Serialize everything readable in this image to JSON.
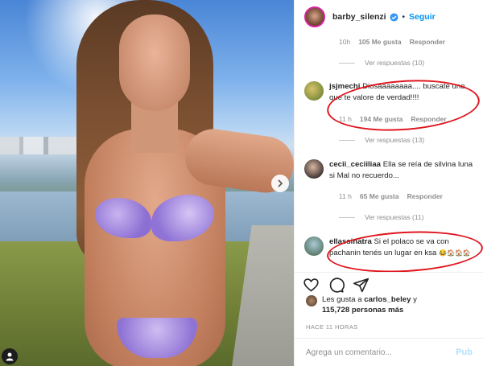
{
  "post": {
    "author": "barby_silenzi",
    "follow_label": "Seguir",
    "separator": "•"
  },
  "comment_top": {
    "time": "10h",
    "likes": "105 Me gusta",
    "reply_label": "Responder",
    "view_replies": "Ver respuestas (10)"
  },
  "comments": [
    {
      "user": "jsjmechi",
      "text": "Diosaaaaaaaa.... buscate uno que te valore de verdad!!!!",
      "time": "11 h",
      "likes": "194 Me gusta",
      "reply_label": "Responder",
      "view_replies": "Ver respuestas (13)"
    },
    {
      "user": "cecii_ceciiliaa",
      "text": "Ella se reía de silvina luna si Mal no recuerdo...",
      "time": "11 h",
      "likes": "65 Me gusta",
      "reply_label": "Responder",
      "view_replies": "Ver respuestas (11)"
    },
    {
      "user": "ellassinatra",
      "text": "Si el polaco se va con pachanin tenés un lugar en ksa",
      "emoji": "😂🏠🏠🏠"
    }
  ],
  "likes": {
    "prefix": "Les gusta a",
    "user": "carlos_beley",
    "conj": "y",
    "count": "115,728 personas más"
  },
  "posted": "HACE 11 HORAS",
  "add_comment": {
    "placeholder": "Agrega un comentario...",
    "publish": "Pub"
  },
  "colors": {
    "accent": "#0095f6",
    "annotation": "#e0161f",
    "muted": "#8e8e8e"
  },
  "icons": [
    "verified-badge-icon",
    "heart-icon",
    "comment-icon",
    "share-icon",
    "chevron-right-icon",
    "user-tag-icon"
  ]
}
